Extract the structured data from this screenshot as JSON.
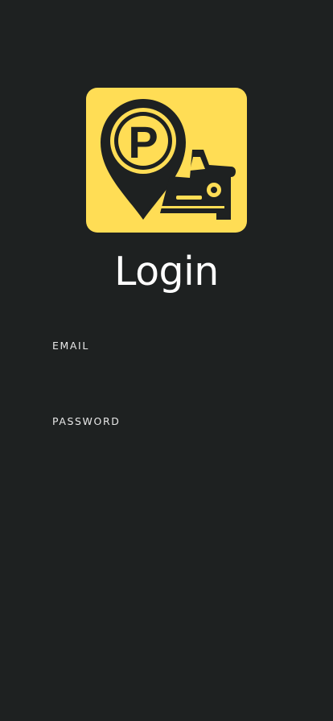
{
  "app": {
    "logo_icon": "parking-pin-car-icon",
    "logo_letter": "P",
    "brand_color": "#ffdd55",
    "background_color": "#1e2121"
  },
  "login": {
    "title": "Login",
    "email_label": "EMAIL",
    "email_value": "",
    "password_label": "PASSWORD",
    "password_value": ""
  }
}
